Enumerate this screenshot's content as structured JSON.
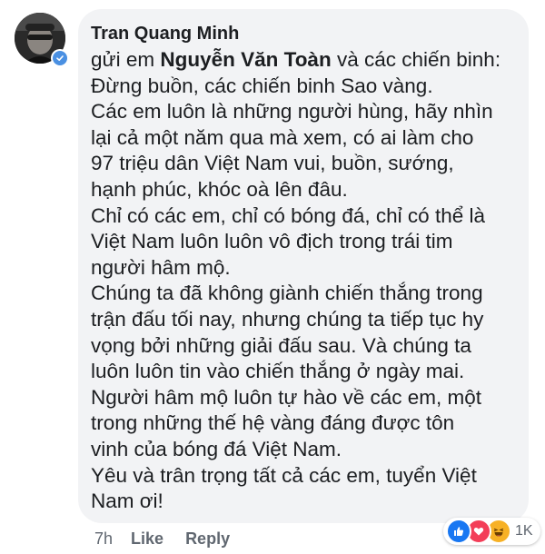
{
  "comment": {
    "author": "Tran Quang Minh",
    "lines": [
      {
        "before": "gửi em ",
        "mention": "Nguyễn Văn Toàn",
        "after": " và các chiến binh:"
      },
      {
        "text": "Đừng buồn, các chiến binh Sao vàng."
      },
      {
        "text": "Các em luôn là những người hùng, hãy nhìn"
      },
      {
        "text": "lại cả một năm qua mà xem, có ai làm cho"
      },
      {
        "text": "97 triệu dân Việt Nam vui, buồn, sướng,"
      },
      {
        "text": "hạnh phúc, khóc oà lên đâu."
      },
      {
        "text": "Chỉ có các em, chỉ có bóng đá, chỉ có thể là"
      },
      {
        "text": "Việt Nam luôn luôn vô địch trong trái tim"
      },
      {
        "text": "người hâm mộ."
      },
      {
        "text": "Chúng ta đã không giành chiến thắng trong"
      },
      {
        "text": "trận đấu tối nay, nhưng chúng ta tiếp tục hy"
      },
      {
        "text": "vọng bởi những giải đấu sau. Và chúng ta"
      },
      {
        "text": "luôn luôn tin vào chiến thắng ở ngày mai."
      },
      {
        "text": "Người hâm mộ luôn tự hào về các em, một"
      },
      {
        "text": "trong những thế hệ vàng đáng được tôn"
      },
      {
        "text": "vinh của bóng đá Việt Nam."
      },
      {
        "text": "Yêu và trân trọng tất cả các em, tuyển Việt"
      },
      {
        "text": "Nam ơi!"
      }
    ]
  },
  "footer": {
    "time": "7h",
    "like_label": "Like",
    "reply_label": "Reply"
  },
  "reactions": {
    "icons": [
      "like-icon",
      "love-icon",
      "haha-icon"
    ],
    "count": "1K"
  },
  "colors": {
    "bubble": "#f2f3f5",
    "text": "#1c1e21",
    "meta": "#606770",
    "like": "#1877f2",
    "love": "#f33e58",
    "haha": "#f7b125",
    "verified": "#4a90e2"
  }
}
